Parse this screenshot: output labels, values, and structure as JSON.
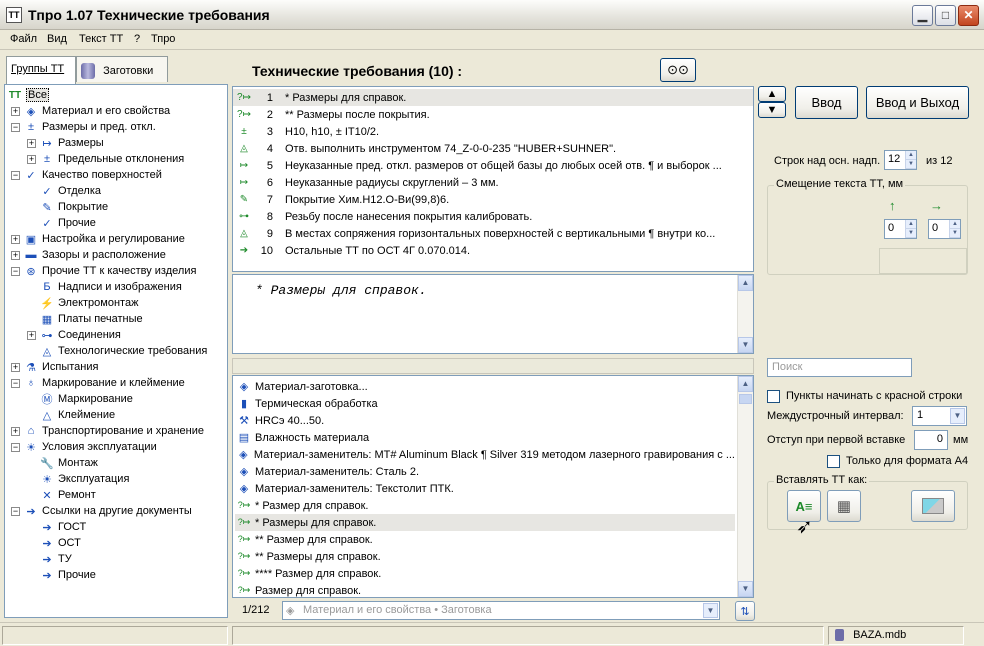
{
  "window": {
    "title": "Тпро 1.07 Технические требования",
    "icon_text": "TT"
  },
  "menu": [
    "Файл",
    "Вид",
    "Текст ТТ",
    "?",
    "Тпро"
  ],
  "left_tabs": [
    {
      "label": "Группы ТТ"
    },
    {
      "label": "Заготовки"
    }
  ],
  "tree": [
    {
      "label": "Все",
      "icon": "tt-root-icon",
      "glyph": "TT",
      "level": 0,
      "expander": ""
    },
    {
      "label": "Материал и его свойства",
      "icon": "material-icon",
      "glyph": "◈",
      "level": 1,
      "expander": "+"
    },
    {
      "label": "Размеры и пред. откл.",
      "icon": "dimension-icon",
      "glyph": "±",
      "level": 1,
      "expander": "−"
    },
    {
      "label": "Размеры",
      "icon": "size-icon",
      "glyph": "↦",
      "level": 2,
      "expander": "+"
    },
    {
      "label": "Предельные отклонения",
      "icon": "tolerance-icon",
      "glyph": "±",
      "level": 2,
      "expander": "+"
    },
    {
      "label": "Качество поверхностей",
      "icon": "surface-check-icon",
      "glyph": "✓",
      "level": 1,
      "expander": "−"
    },
    {
      "label": "Отделка",
      "icon": "finish-icon",
      "glyph": "✓",
      "level": 2,
      "expander": ""
    },
    {
      "label": "Покрытие",
      "icon": "coating-icon",
      "glyph": "✎",
      "level": 2,
      "expander": ""
    },
    {
      "label": "Прочие",
      "icon": "other-check-icon",
      "glyph": "✓",
      "level": 2,
      "expander": ""
    },
    {
      "label": "Настройка и регулирование",
      "icon": "monitor-icon",
      "glyph": "▣",
      "level": 1,
      "expander": "+"
    },
    {
      "label": "Зазоры и расположение",
      "icon": "gap-icon",
      "glyph": "▬",
      "level": 1,
      "expander": "+"
    },
    {
      "label": "Прочие ТТ к качеству изделия",
      "icon": "quality-icon",
      "glyph": "⊛",
      "level": 1,
      "expander": "−"
    },
    {
      "label": "Надписи и изображения",
      "icon": "inscription-icon",
      "glyph": "Б",
      "level": 2,
      "expander": ""
    },
    {
      "label": "Электромонтаж",
      "icon": "wiring-icon",
      "glyph": "⚡",
      "level": 2,
      "expander": ""
    },
    {
      "label": "Платы печатные",
      "icon": "pcb-icon",
      "glyph": "▦",
      "level": 2,
      "expander": ""
    },
    {
      "label": "Соединения",
      "icon": "connection-icon",
      "glyph": "⊶",
      "level": 2,
      "expander": "+"
    },
    {
      "label": "Технологические требования",
      "icon": "tech-req-icon",
      "glyph": "◬",
      "level": 2,
      "expander": ""
    },
    {
      "label": "Испытания",
      "icon": "test-icon",
      "glyph": "⚗",
      "level": 1,
      "expander": "+"
    },
    {
      "label": "Маркирование и клеймение",
      "icon": "marking-icon",
      "glyph": "♁",
      "level": 1,
      "expander": "−"
    },
    {
      "label": "Маркирование",
      "icon": "mark-icon",
      "glyph": "Ⓜ",
      "level": 2,
      "expander": ""
    },
    {
      "label": "Клеймение",
      "icon": "stamp-icon",
      "glyph": "△",
      "level": 2,
      "expander": ""
    },
    {
      "label": "Транспортирование и хранение",
      "icon": "transport-icon",
      "glyph": "⌂",
      "level": 1,
      "expander": "+"
    },
    {
      "label": "Условия эксплуатации",
      "icon": "sun-icon",
      "glyph": "☀",
      "level": 1,
      "expander": "−"
    },
    {
      "label": "Монтаж",
      "icon": "wrench-icon",
      "glyph": "🔧",
      "level": 2,
      "expander": ""
    },
    {
      "label": "Эксплуатация",
      "icon": "operation-icon",
      "glyph": "☀",
      "level": 2,
      "expander": ""
    },
    {
      "label": "Ремонт",
      "icon": "repair-icon",
      "glyph": "✕",
      "level": 2,
      "expander": ""
    },
    {
      "label": "Ссылки на другие документы",
      "icon": "links-icon",
      "glyph": "➔",
      "level": 1,
      "expander": "−"
    },
    {
      "label": "ГОСТ",
      "icon": "gost-icon",
      "glyph": "➔",
      "level": 2,
      "expander": ""
    },
    {
      "label": "ОСТ",
      "icon": "ost-icon",
      "glyph": "➔",
      "level": 2,
      "expander": ""
    },
    {
      "label": "ТУ",
      "icon": "tu-icon",
      "glyph": "➔",
      "level": 2,
      "expander": ""
    },
    {
      "label": "Прочие",
      "icon": "other-docs-icon",
      "glyph": "➔",
      "level": 2,
      "expander": ""
    }
  ],
  "heading": "Технические требования (10) :",
  "tt_items": [
    {
      "num": "1",
      "text": "* Размеры для справок.",
      "icon": "question-dimension-icon",
      "glyph": "?↦"
    },
    {
      "num": "2",
      "text": "** Размеры после покрытия.",
      "icon": "question-dimension-icon",
      "glyph": "?↦"
    },
    {
      "num": "3",
      "text": "H10, h10, ± IT10/2.",
      "icon": "tolerance-icon",
      "glyph": "±"
    },
    {
      "num": "4",
      "text": "Отв. выполнить инструментом 74_Z-0-0-235 \"HUBER+SUHNER\".",
      "icon": "tech-req-icon",
      "glyph": "◬"
    },
    {
      "num": "5",
      "text": "Неуказанные пред. откл. размеров от общей базы до любых осей отв. ¶ и выборок ...",
      "icon": "dimension-icon",
      "glyph": "↦"
    },
    {
      "num": "6",
      "text": "Неуказанные радиусы скруглений – 3 мм.",
      "icon": "dimension-icon",
      "glyph": "↦"
    },
    {
      "num": "7",
      "text": "Покрытие Хим.Н12.О-Ви(99,8)6.",
      "icon": "coating-icon",
      "glyph": "✎"
    },
    {
      "num": "8",
      "text": "Резьбу после нанесения покрытия калибровать.",
      "icon": "connection-icon",
      "glyph": "⊶"
    },
    {
      "num": "9",
      "text": "В местах сопряжения горизонтальных поверхностей с вертикальными ¶ внутри ко...",
      "icon": "tech-req-icon",
      "glyph": "◬"
    },
    {
      "num": "10",
      "text": "Остальные ТТ по ОСТ 4Г 0.070.014.",
      "icon": "links-icon",
      "glyph": "➔"
    }
  ],
  "preview_text": "* Размеры для справок.",
  "library": [
    {
      "text": "Материал-заготовка...",
      "icon": "material-icon",
      "glyph": "◈"
    },
    {
      "text": "Термическая обработка",
      "icon": "heat-icon",
      "glyph": "▮"
    },
    {
      "text": "HRCэ 40...50.",
      "icon": "hammer-icon",
      "glyph": "⚒"
    },
    {
      "text": "Влажность материала",
      "icon": "humidity-icon",
      "glyph": "▤"
    },
    {
      "text": "Материал-заменитель: MT# Aluminum Black ¶ Silver 319 методом лазерного гравирования с ...",
      "icon": "material-icon",
      "glyph": "◈"
    },
    {
      "text": "Материал-заменитель: Сталь 2.",
      "icon": "material-icon",
      "glyph": "◈"
    },
    {
      "text": "Материал-заменитель: Текстолит ПТК.",
      "icon": "material-icon",
      "glyph": "◈"
    },
    {
      "text": "* Размер для справок.",
      "icon": "question-dimension-icon",
      "glyph": "?↦"
    },
    {
      "text": "* Размеры для справок.",
      "icon": "question-dimension-icon",
      "glyph": "?↦"
    },
    {
      "text": "** Размер для справок.",
      "icon": "question-dimension-icon",
      "glyph": "?↦"
    },
    {
      "text": "** Размеры для справок.",
      "icon": "question-dimension-icon",
      "glyph": "?↦"
    },
    {
      "text": "**** Размер для справок.",
      "icon": "question-dimension-icon",
      "glyph": "?↦"
    },
    {
      "text": "Размер для справок.",
      "icon": "question-dimension-icon",
      "glyph": "?↦"
    }
  ],
  "pager": "1/212",
  "filter_path": "Материал и его свойства • Заготовка",
  "buttons": {
    "enter": "Ввод",
    "enter_exit": "Ввод и Выход"
  },
  "lines": {
    "label": "Строк над осн. надп.",
    "value": "12",
    "of": "из 12"
  },
  "offset": {
    "title": "Смещение текста ТТ, мм",
    "up_value": "0",
    "right_value": "0"
  },
  "search_placeholder": "Поиск",
  "red_line_label": "Пункты начинать с красной строки",
  "line_spacing": {
    "label": "Междустрочный интервал:",
    "value": "1"
  },
  "first_indent": {
    "label": "Отступ при первой вставке",
    "value": "0",
    "unit": "мм"
  },
  "a4_only": "Только для формата А4",
  "insert_as": "Вставлять ТТ как:",
  "status": {
    "db": "BAZA.mdb"
  }
}
